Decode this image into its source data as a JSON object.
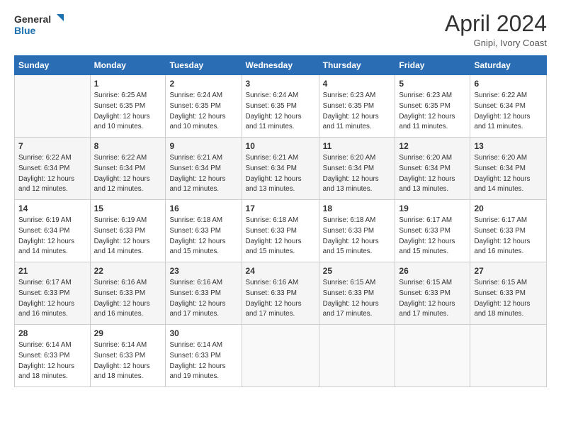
{
  "logo": {
    "line1": "General",
    "line2": "Blue"
  },
  "title": "April 2024",
  "subtitle": "Gnipi, Ivory Coast",
  "days_of_week": [
    "Sunday",
    "Monday",
    "Tuesday",
    "Wednesday",
    "Thursday",
    "Friday",
    "Saturday"
  ],
  "weeks": [
    [
      {
        "day": "",
        "empty": true
      },
      {
        "day": "1",
        "sunrise": "6:25 AM",
        "sunset": "6:35 PM",
        "daylight": "12 hours and 10 minutes."
      },
      {
        "day": "2",
        "sunrise": "6:24 AM",
        "sunset": "6:35 PM",
        "daylight": "12 hours and 10 minutes."
      },
      {
        "day": "3",
        "sunrise": "6:24 AM",
        "sunset": "6:35 PM",
        "daylight": "12 hours and 11 minutes."
      },
      {
        "day": "4",
        "sunrise": "6:23 AM",
        "sunset": "6:35 PM",
        "daylight": "12 hours and 11 minutes."
      },
      {
        "day": "5",
        "sunrise": "6:23 AM",
        "sunset": "6:35 PM",
        "daylight": "12 hours and 11 minutes."
      },
      {
        "day": "6",
        "sunrise": "6:22 AM",
        "sunset": "6:34 PM",
        "daylight": "12 hours and 11 minutes."
      }
    ],
    [
      {
        "day": "7",
        "sunrise": "6:22 AM",
        "sunset": "6:34 PM",
        "daylight": "12 hours and 12 minutes."
      },
      {
        "day": "8",
        "sunrise": "6:22 AM",
        "sunset": "6:34 PM",
        "daylight": "12 hours and 12 minutes."
      },
      {
        "day": "9",
        "sunrise": "6:21 AM",
        "sunset": "6:34 PM",
        "daylight": "12 hours and 12 minutes."
      },
      {
        "day": "10",
        "sunrise": "6:21 AM",
        "sunset": "6:34 PM",
        "daylight": "12 hours and 13 minutes."
      },
      {
        "day": "11",
        "sunrise": "6:20 AM",
        "sunset": "6:34 PM",
        "daylight": "12 hours and 13 minutes."
      },
      {
        "day": "12",
        "sunrise": "6:20 AM",
        "sunset": "6:34 PM",
        "daylight": "12 hours and 13 minutes."
      },
      {
        "day": "13",
        "sunrise": "6:20 AM",
        "sunset": "6:34 PM",
        "daylight": "12 hours and 14 minutes."
      }
    ],
    [
      {
        "day": "14",
        "sunrise": "6:19 AM",
        "sunset": "6:34 PM",
        "daylight": "12 hours and 14 minutes."
      },
      {
        "day": "15",
        "sunrise": "6:19 AM",
        "sunset": "6:33 PM",
        "daylight": "12 hours and 14 minutes."
      },
      {
        "day": "16",
        "sunrise": "6:18 AM",
        "sunset": "6:33 PM",
        "daylight": "12 hours and 15 minutes."
      },
      {
        "day": "17",
        "sunrise": "6:18 AM",
        "sunset": "6:33 PM",
        "daylight": "12 hours and 15 minutes."
      },
      {
        "day": "18",
        "sunrise": "6:18 AM",
        "sunset": "6:33 PM",
        "daylight": "12 hours and 15 minutes."
      },
      {
        "day": "19",
        "sunrise": "6:17 AM",
        "sunset": "6:33 PM",
        "daylight": "12 hours and 15 minutes."
      },
      {
        "day": "20",
        "sunrise": "6:17 AM",
        "sunset": "6:33 PM",
        "daylight": "12 hours and 16 minutes."
      }
    ],
    [
      {
        "day": "21",
        "sunrise": "6:17 AM",
        "sunset": "6:33 PM",
        "daylight": "12 hours and 16 minutes."
      },
      {
        "day": "22",
        "sunrise": "6:16 AM",
        "sunset": "6:33 PM",
        "daylight": "12 hours and 16 minutes."
      },
      {
        "day": "23",
        "sunrise": "6:16 AM",
        "sunset": "6:33 PM",
        "daylight": "12 hours and 17 minutes."
      },
      {
        "day": "24",
        "sunrise": "6:16 AM",
        "sunset": "6:33 PM",
        "daylight": "12 hours and 17 minutes."
      },
      {
        "day": "25",
        "sunrise": "6:15 AM",
        "sunset": "6:33 PM",
        "daylight": "12 hours and 17 minutes."
      },
      {
        "day": "26",
        "sunrise": "6:15 AM",
        "sunset": "6:33 PM",
        "daylight": "12 hours and 17 minutes."
      },
      {
        "day": "27",
        "sunrise": "6:15 AM",
        "sunset": "6:33 PM",
        "daylight": "12 hours and 18 minutes."
      }
    ],
    [
      {
        "day": "28",
        "sunrise": "6:14 AM",
        "sunset": "6:33 PM",
        "daylight": "12 hours and 18 minutes."
      },
      {
        "day": "29",
        "sunrise": "6:14 AM",
        "sunset": "6:33 PM",
        "daylight": "12 hours and 18 minutes."
      },
      {
        "day": "30",
        "sunrise": "6:14 AM",
        "sunset": "6:33 PM",
        "daylight": "12 hours and 19 minutes."
      },
      {
        "day": "",
        "empty": true
      },
      {
        "day": "",
        "empty": true
      },
      {
        "day": "",
        "empty": true
      },
      {
        "day": "",
        "empty": true
      }
    ]
  ]
}
